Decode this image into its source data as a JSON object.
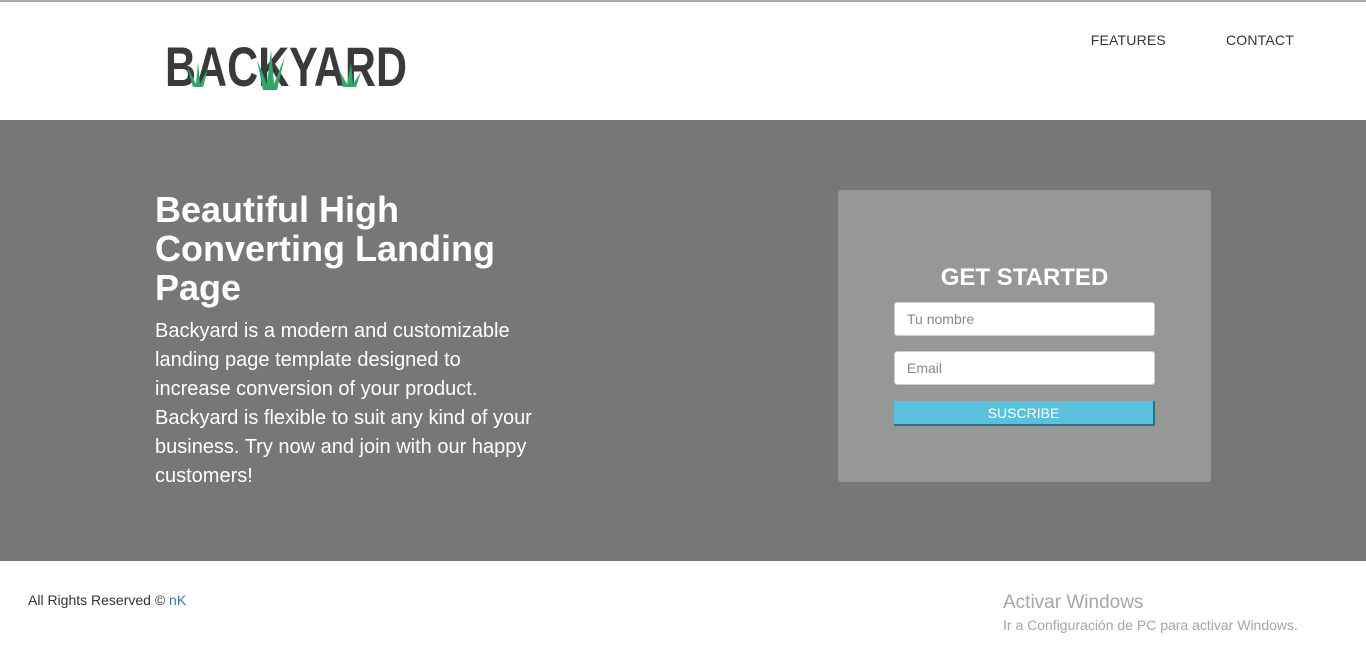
{
  "header": {
    "logo_text": "BACKYARD",
    "nav": [
      {
        "label": "FEATURES"
      },
      {
        "label": "CONTACT"
      }
    ]
  },
  "hero": {
    "title": "Beautiful High Converting Landing Page",
    "description": "Backyard is a modern and customizable landing page template designed to increase conversion of your product. Backyard is flexible to suit any kind of your business. Try now and join with our happy customers!"
  },
  "signup": {
    "title": "GET STARTED",
    "name_placeholder": "Tu nombre",
    "email_placeholder": "Email",
    "submit_label": "SUSCRIBE"
  },
  "footer": {
    "copyright": "All Rights Reserved ©",
    "author": "nK"
  },
  "windows_watermark": {
    "title": "Activar Windows",
    "subtitle": "Ir a Configuración de PC para activar Windows."
  },
  "colors": {
    "hero_bg": "#777777",
    "card_bg": "#979797",
    "button": "#5bc0de",
    "logo_text": "#3a3a3a",
    "grass": "#2fa86a",
    "link": "#337ab7"
  },
  "icons": [
    "grass-icon"
  ]
}
